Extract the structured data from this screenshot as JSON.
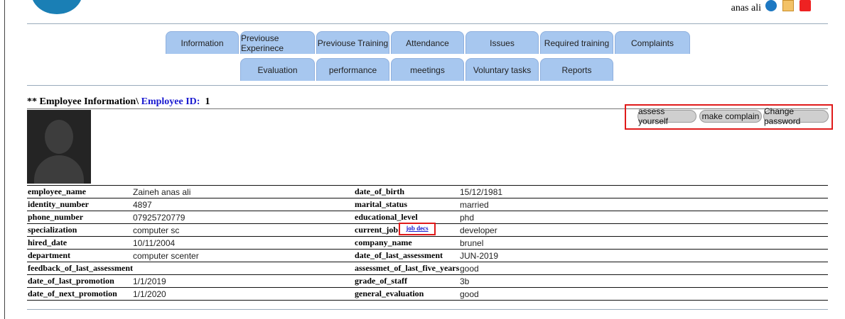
{
  "header": {
    "user_name": "anas ali"
  },
  "tabs_row1": [
    "Information",
    "Previouse Experinece",
    "Previouse Training",
    "Attendance",
    "Issues",
    "Required training",
    "Complaints"
  ],
  "tabs_row2": [
    "Evaluation",
    "performance",
    "meetings",
    "Voluntary tasks",
    "Reports"
  ],
  "heading": {
    "prefix": "** Employee Information\\",
    "id_label": " Employee ID:",
    "id_value": "1"
  },
  "actions": {
    "assess": "assess yourself",
    "complain": "make complain",
    "password": "Change password"
  },
  "job_link": "job decs",
  "rows": [
    {
      "l1": "employee_name",
      "v1": "Zaineh anas ali",
      "l2": "date_of_birth",
      "v2": "15/12/1981"
    },
    {
      "l1": "identity_number",
      "v1": "4897",
      "l2": "marital_status",
      "v2": "married"
    },
    {
      "l1": "phone_number",
      "v1": "07925720779",
      "l2": "educational_level",
      "v2": "phd"
    },
    {
      "l1": "specialization",
      "v1": "computer sc",
      "l2": "current_job",
      "v2": "developer"
    },
    {
      "l1": "hired_date",
      "v1": "10/11/2004",
      "l2": "company_name",
      "v2": "brunel"
    },
    {
      "l1": "department",
      "v1": "computer scenter",
      "l2": "date_of_last_assessment",
      "v2": "JUN-2019"
    },
    {
      "l1": "feedback_of_last_assessment",
      "v1": "",
      "l2": "assessmet_of_last_five_years",
      "v2": "good"
    },
    {
      "l1": "date_of_last_promotion",
      "v1": "1/1/2019",
      "l2": "grade_of_staff",
      "v2": "3b"
    },
    {
      "l1": "date_of_next_promotion",
      "v1": "1/1/2020",
      "l2": "general_evaluation",
      "v2": "good"
    }
  ]
}
